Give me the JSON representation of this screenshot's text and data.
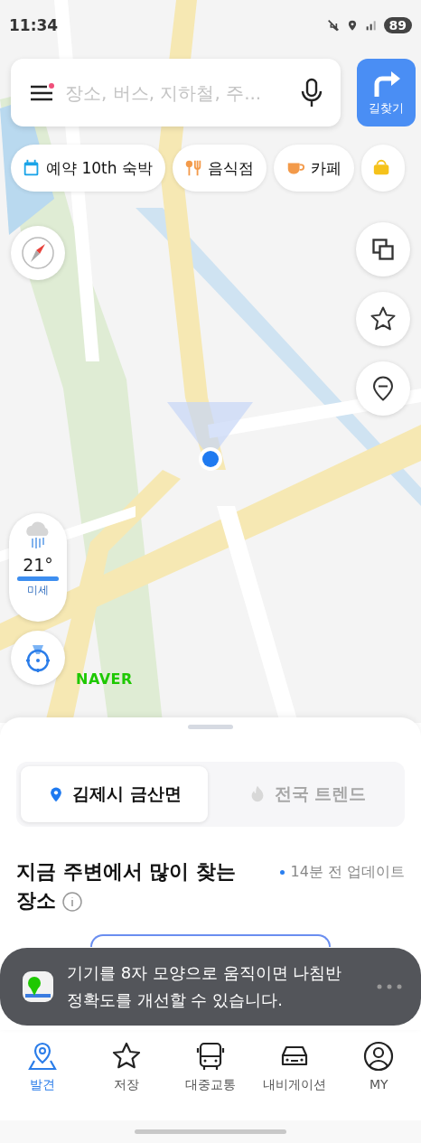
{
  "status_bar": {
    "time": "11:34",
    "battery": "89"
  },
  "search": {
    "placeholder": "장소, 버스, 지하철, 주...",
    "menu_badge": true
  },
  "directions_button": {
    "label": "길찾기"
  },
  "chips": [
    {
      "kind": "calendar",
      "label": "예약 10th 숙박"
    },
    {
      "kind": "food",
      "label": "음식점"
    },
    {
      "kind": "cafe",
      "label": "카페"
    },
    {
      "kind": "partial"
    }
  ],
  "weather": {
    "temperature": "21°",
    "dust_label": "미세",
    "level": 1
  },
  "map_logo": "NAVER",
  "sheet": {
    "tabs": [
      {
        "label": "김제시 금산면",
        "selected": true
      },
      {
        "label": "전국 트렌드",
        "selected": false
      }
    ],
    "heading": "지금 주변에서 많이 찾는 장소",
    "updated": "14분 전 업데이트"
  },
  "toast": {
    "text": "기기를 8자 모양으로 움직이면 나침반\n정확도를 개선할 수 있습니다."
  },
  "nav": [
    {
      "kind": "discover",
      "label": "발견",
      "selected": true
    },
    {
      "kind": "saved",
      "label": "저장",
      "selected": false
    },
    {
      "kind": "transit",
      "label": "대중교통",
      "selected": false
    },
    {
      "kind": "navigation",
      "label": "내비게이션",
      "selected": false
    },
    {
      "kind": "my",
      "label": "MY",
      "selected": false
    }
  ]
}
